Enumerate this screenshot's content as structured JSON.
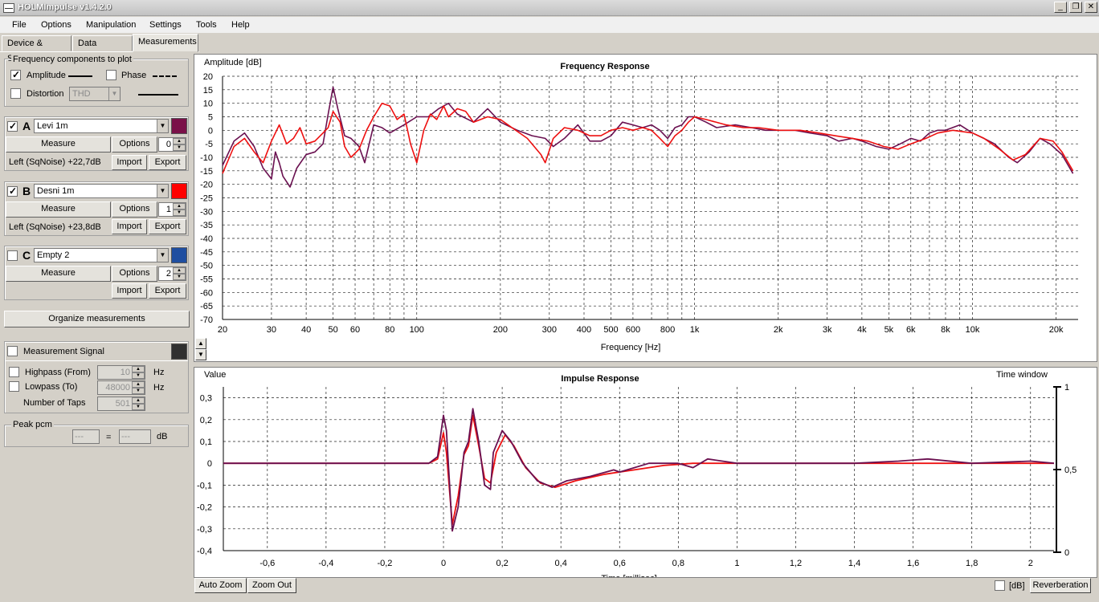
{
  "window": {
    "title": "HOLMImpulse  v1.4.2.0",
    "minimize": "_",
    "restore": "❐",
    "close": "✕"
  },
  "menu": [
    "File",
    "Options",
    "Manipulation",
    "Settings",
    "Tools",
    "Help"
  ],
  "tabs": [
    "Device & Signal",
    "Data analysis",
    "Measurements"
  ],
  "freq_components": {
    "title": "Frequency components to plot",
    "amplitude": "Amplitude",
    "phase": "Phase",
    "distortion": "Distortion",
    "distortion_select": "THD"
  },
  "measurements": [
    {
      "letter": "A",
      "name": "Levi 1m",
      "color": "#7a1048",
      "checked": true,
      "index": "0",
      "status": "Left (SqNoise) +22,7dB"
    },
    {
      "letter": "B",
      "name": "Desni 1m",
      "color": "#ff0000",
      "checked": true,
      "index": "1",
      "status": "Left (SqNoise) +23,8dB"
    },
    {
      "letter": "C",
      "name": "Empty 2",
      "color": "#1f4ea0",
      "checked": false,
      "index": "2",
      "status": ""
    }
  ],
  "buttons": {
    "measure": "Measure",
    "options": "Options",
    "import": "Import",
    "export": "Export",
    "organize": "Organize measurements",
    "auto_zoom": "Auto Zoom",
    "zoom_out": "Zoom Out",
    "reverberation": "Reverberation"
  },
  "measurement_signal": {
    "label": "Measurement Signal",
    "highpass": "Highpass (From)",
    "highpass_value": "10",
    "hz1": "Hz",
    "lowpass": "Lowpass (To)",
    "lowpass_value": "48000",
    "hz2": "Hz",
    "taps": "Number of Taps",
    "taps_value": "501"
  },
  "peak": {
    "title": "Peak pcm",
    "value1": "---",
    "equals": "=",
    "value2": "---",
    "unit": "dB"
  },
  "db_checkbox": "[dB]",
  "chart_data": [
    {
      "type": "line",
      "title": "Frequency Response",
      "ylabel": "Amplitude [dB]",
      "xlabel": "Frequency [Hz]",
      "xscale": "log",
      "xlim": [
        20,
        24000
      ],
      "ylim": [
        -70,
        20
      ],
      "yticks": [
        "20",
        "15",
        "10",
        "5",
        "0",
        "-5",
        "-10",
        "-15",
        "-20",
        "-25",
        "-30",
        "-35",
        "-40",
        "-45",
        "-50",
        "-55",
        "-60",
        "-65",
        "-70"
      ],
      "xtick_labels": [
        {
          "v": 20,
          "t": "20"
        },
        {
          "v": 30,
          "t": "30"
        },
        {
          "v": 40,
          "t": "40"
        },
        {
          "v": 50,
          "t": "50"
        },
        {
          "v": 60,
          "t": "60"
        },
        {
          "v": 80,
          "t": "80"
        },
        {
          "v": 100,
          "t": "100"
        },
        {
          "v": 200,
          "t": "200"
        },
        {
          "v": 300,
          "t": "300"
        },
        {
          "v": 400,
          "t": "400"
        },
        {
          "v": 500,
          "t": "500"
        },
        {
          "v": 600,
          "t": "600"
        },
        {
          "v": 800,
          "t": "800"
        },
        {
          "v": 1000,
          "t": "1k"
        },
        {
          "v": 2000,
          "t": "2k"
        },
        {
          "v": 3000,
          "t": "3k"
        },
        {
          "v": 4000,
          "t": "4k"
        },
        {
          "v": 5000,
          "t": "5k"
        },
        {
          "v": 6000,
          "t": "6k"
        },
        {
          "v": 8000,
          "t": "8k"
        },
        {
          "v": 10000,
          "t": "10k"
        },
        {
          "v": 20000,
          "t": "20k"
        }
      ],
      "grid": true,
      "series": [
        {
          "color": "#6a1050",
          "points": [
            [
              20,
              -13
            ],
            [
              22,
              -4
            ],
            [
              24,
              -1
            ],
            [
              26,
              -6
            ],
            [
              28,
              -14
            ],
            [
              30,
              -18
            ],
            [
              31,
              -8
            ],
            [
              32,
              -12
            ],
            [
              33,
              -17
            ],
            [
              35,
              -21
            ],
            [
              37,
              -14
            ],
            [
              40,
              -9
            ],
            [
              43,
              -8
            ],
            [
              46,
              -5
            ],
            [
              48,
              6
            ],
            [
              50,
              16
            ],
            [
              52,
              8
            ],
            [
              55,
              -2
            ],
            [
              58,
              -3
            ],
            [
              62,
              -6
            ],
            [
              65,
              -12
            ],
            [
              70,
              2
            ],
            [
              75,
              1
            ],
            [
              80,
              -1
            ],
            [
              90,
              2
            ],
            [
              100,
              5
            ],
            [
              110,
              5
            ],
            [
              120,
              8
            ],
            [
              130,
              10
            ],
            [
              140,
              6
            ],
            [
              160,
              3
            ],
            [
              180,
              8
            ],
            [
              200,
              3
            ],
            [
              230,
              0
            ],
            [
              260,
              -2
            ],
            [
              290,
              -3
            ],
            [
              310,
              -6
            ],
            [
              340,
              -3
            ],
            [
              380,
              2
            ],
            [
              420,
              -4
            ],
            [
              460,
              -4
            ],
            [
              500,
              -2
            ],
            [
              550,
              3
            ],
            [
              600,
              2
            ],
            [
              650,
              1
            ],
            [
              700,
              2
            ],
            [
              750,
              0
            ],
            [
              800,
              -3
            ],
            [
              850,
              1
            ],
            [
              900,
              2
            ],
            [
              950,
              5
            ],
            [
              1000,
              5
            ],
            [
              1100,
              3
            ],
            [
              1200,
              1
            ],
            [
              1400,
              2
            ],
            [
              1600,
              1
            ],
            [
              1800,
              0
            ],
            [
              2000,
              0
            ],
            [
              2300,
              0
            ],
            [
              2600,
              -1
            ],
            [
              3000,
              -2
            ],
            [
              3300,
              -4
            ],
            [
              3700,
              -3
            ],
            [
              4000,
              -4
            ],
            [
              4500,
              -6
            ],
            [
              5000,
              -7
            ],
            [
              5500,
              -5
            ],
            [
              6000,
              -3
            ],
            [
              6500,
              -4
            ],
            [
              7000,
              -1
            ],
            [
              7500,
              0
            ],
            [
              8000,
              0
            ],
            [
              9000,
              2
            ],
            [
              10000,
              -1
            ],
            [
              11000,
              -3
            ],
            [
              12000,
              -5
            ],
            [
              13500,
              -10
            ],
            [
              14500,
              -12
            ],
            [
              16000,
              -8
            ],
            [
              17500,
              -3
            ],
            [
              19000,
              -5
            ],
            [
              21000,
              -9
            ],
            [
              23000,
              -16
            ]
          ]
        },
        {
          "color": "#ee1010",
          "points": [
            [
              20,
              -16
            ],
            [
              22,
              -6
            ],
            [
              24,
              -3
            ],
            [
              26,
              -8
            ],
            [
              28,
              -12
            ],
            [
              30,
              -4
            ],
            [
              32,
              2
            ],
            [
              34,
              -5
            ],
            [
              36,
              -3
            ],
            [
              38,
              1
            ],
            [
              40,
              -5
            ],
            [
              43,
              -4
            ],
            [
              46,
              -1
            ],
            [
              48,
              1
            ],
            [
              50,
              7
            ],
            [
              53,
              3
            ],
            [
              55,
              -6
            ],
            [
              58,
              -10
            ],
            [
              62,
              -7
            ],
            [
              66,
              0
            ],
            [
              70,
              5
            ],
            [
              75,
              10
            ],
            [
              80,
              9
            ],
            [
              85,
              4
            ],
            [
              90,
              6
            ],
            [
              95,
              -5
            ],
            [
              100,
              -12
            ],
            [
              106,
              0
            ],
            [
              112,
              6
            ],
            [
              118,
              4
            ],
            [
              125,
              9
            ],
            [
              130,
              5
            ],
            [
              140,
              8
            ],
            [
              150,
              7
            ],
            [
              160,
              3
            ],
            [
              180,
              5
            ],
            [
              200,
              4
            ],
            [
              220,
              1
            ],
            [
              250,
              -3
            ],
            [
              280,
              -9
            ],
            [
              290,
              -12
            ],
            [
              310,
              -3
            ],
            [
              340,
              1
            ],
            [
              380,
              0
            ],
            [
              420,
              -2
            ],
            [
              460,
              -2
            ],
            [
              500,
              0
            ],
            [
              550,
              1
            ],
            [
              600,
              0
            ],
            [
              650,
              1
            ],
            [
              700,
              0
            ],
            [
              750,
              -3
            ],
            [
              800,
              -6
            ],
            [
              850,
              -2
            ],
            [
              900,
              0
            ],
            [
              950,
              3
            ],
            [
              1000,
              5
            ],
            [
              1100,
              4
            ],
            [
              1300,
              2
            ],
            [
              1500,
              1
            ],
            [
              1700,
              1
            ],
            [
              2000,
              0
            ],
            [
              2400,
              0
            ],
            [
              2800,
              -1
            ],
            [
              3200,
              -2
            ],
            [
              3700,
              -3
            ],
            [
              4200,
              -4
            ],
            [
              4800,
              -6
            ],
            [
              5400,
              -7
            ],
            [
              6000,
              -5
            ],
            [
              6800,
              -3
            ],
            [
              7500,
              -1
            ],
            [
              8500,
              0
            ],
            [
              10000,
              -1
            ],
            [
              11000,
              -3
            ],
            [
              12500,
              -7
            ],
            [
              14000,
              -11
            ],
            [
              15500,
              -9
            ],
            [
              17500,
              -3
            ],
            [
              19500,
              -4
            ],
            [
              21000,
              -8
            ],
            [
              23000,
              -15
            ]
          ]
        }
      ]
    },
    {
      "type": "line",
      "title": "Impulse Response",
      "ylabel": "Value",
      "xlabel": "Time [millisec]",
      "y2label": "Time window",
      "xlim": [
        -0.75,
        2.08
      ],
      "ylim": [
        -0.4,
        0.35
      ],
      "yticks": [
        "0,3",
        "0,2",
        "0,1",
        "0",
        "-0,1",
        "-0,2",
        "-0,3",
        "-0,4"
      ],
      "y2ticks": [
        "1",
        "0,5",
        "0"
      ],
      "xticks": [
        "-0,6",
        "-0,4",
        "-0,2",
        "0",
        "0,2",
        "0,4",
        "0,6",
        "0,8",
        "1",
        "1,2",
        "1,4",
        "1,6",
        "1,8",
        "2"
      ],
      "grid": true,
      "series": [
        {
          "color": "#6a1050",
          "points": [
            [
              -0.75,
              0
            ],
            [
              -0.3,
              0
            ],
            [
              -0.05,
              0
            ],
            [
              -0.02,
              0.03
            ],
            [
              0,
              0.22
            ],
            [
              0.01,
              0.15
            ],
            [
              0.03,
              -0.31
            ],
            [
              0.05,
              -0.2
            ],
            [
              0.07,
              0.05
            ],
            [
              0.085,
              0.1
            ],
            [
              0.1,
              0.25
            ],
            [
              0.12,
              0.1
            ],
            [
              0.14,
              -0.1
            ],
            [
              0.16,
              -0.12
            ],
            [
              0.17,
              0.05
            ],
            [
              0.2,
              0.15
            ],
            [
              0.23,
              0.1
            ],
            [
              0.27,
              0
            ],
            [
              0.32,
              -0.08
            ],
            [
              0.37,
              -0.11
            ],
            [
              0.42,
              -0.08
            ],
            [
              0.5,
              -0.06
            ],
            [
              0.58,
              -0.03
            ],
            [
              0.6,
              -0.04
            ],
            [
              0.7,
              0
            ],
            [
              0.8,
              0
            ],
            [
              0.85,
              -0.02
            ],
            [
              0.9,
              0.02
            ],
            [
              1.0,
              0
            ],
            [
              1.2,
              0
            ],
            [
              1.4,
              0
            ],
            [
              1.55,
              0.01
            ],
            [
              1.65,
              0.02
            ],
            [
              1.8,
              0
            ],
            [
              2.0,
              0.01
            ],
            [
              2.08,
              0
            ]
          ]
        },
        {
          "color": "#ee1010",
          "points": [
            [
              -0.75,
              0
            ],
            [
              -0.3,
              0
            ],
            [
              -0.05,
              0
            ],
            [
              -0.02,
              0.02
            ],
            [
              0,
              0.14
            ],
            [
              0.01,
              0.05
            ],
            [
              0.03,
              -0.28
            ],
            [
              0.05,
              -0.15
            ],
            [
              0.07,
              0.04
            ],
            [
              0.085,
              0.08
            ],
            [
              0.1,
              0.22
            ],
            [
              0.12,
              0.08
            ],
            [
              0.14,
              -0.07
            ],
            [
              0.16,
              -0.09
            ],
            [
              0.18,
              0.05
            ],
            [
              0.21,
              0.13
            ],
            [
              0.24,
              0.08
            ],
            [
              0.28,
              -0.02
            ],
            [
              0.33,
              -0.09
            ],
            [
              0.38,
              -0.11
            ],
            [
              0.45,
              -0.08
            ],
            [
              0.55,
              -0.05
            ],
            [
              0.65,
              -0.03
            ],
            [
              0.75,
              -0.01
            ],
            [
              0.85,
              0
            ],
            [
              1.0,
              0
            ],
            [
              1.5,
              0
            ],
            [
              2.0,
              0
            ],
            [
              2.08,
              0
            ]
          ]
        }
      ]
    }
  ]
}
